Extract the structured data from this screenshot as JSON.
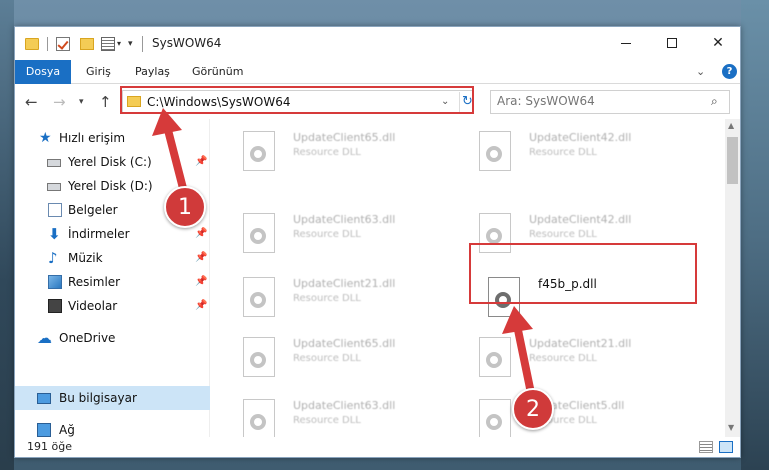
{
  "window": {
    "title": "SysWOW64",
    "min_label": "",
    "close_label": "✕"
  },
  "ribbon": {
    "file_tab": "Dosya",
    "home_tab": "Giriş",
    "share_tab": "Paylaş",
    "view_tab": "Görünüm"
  },
  "nav": {
    "address": "C:\\Windows\\SysWOW64",
    "search_placeholder": "Ara: SysWOW64"
  },
  "sidebar": {
    "items": [
      {
        "label": "Hızlı erişim",
        "icon": "star-icon"
      },
      {
        "label": "Yerel Disk (C:)",
        "icon": "drive-icon"
      },
      {
        "label": "Yerel Disk (D:)",
        "icon": "drive-icon"
      },
      {
        "label": "Belgeler",
        "icon": "documents-icon"
      },
      {
        "label": "İndirmeler",
        "icon": "downloads-icon"
      },
      {
        "label": "Müzik",
        "icon": "music-icon"
      },
      {
        "label": "Resimler",
        "icon": "pictures-icon"
      },
      {
        "label": "Videolar",
        "icon": "videos-icon"
      },
      {
        "label": "OneDrive",
        "icon": "cloud-icon"
      },
      {
        "label": "Bu bilgisayar",
        "icon": "computer-icon"
      },
      {
        "label": "Ağ",
        "icon": "network-icon"
      }
    ]
  },
  "files": [
    {
      "name": "UpdateClient65.dll",
      "type": "Resource DLL"
    },
    {
      "name": "UpdateClient42.dll",
      "type": "Resource DLL"
    },
    {
      "name": "UpdateClient63.dll",
      "type": "Resource DLL"
    },
    {
      "name": "UpdateClient42.dll",
      "type": "Resource DLL"
    },
    {
      "name": "UpdateClient21.dll",
      "type": "Resource DLL"
    },
    {
      "name": "f45b_p.dll",
      "type": ""
    },
    {
      "name": "UpdateClient65.dll",
      "type": "Resource DLL"
    },
    {
      "name": "UpdateClient21.dll",
      "type": "Resource DLL"
    },
    {
      "name": "UpdateClient63.dll",
      "type": "Resource DLL"
    },
    {
      "name": "UpdateClient5.dll",
      "type": "Resource DLL"
    }
  ],
  "status": {
    "item_count": "191 öğe"
  },
  "annotations": {
    "step1": "1",
    "step2": "2",
    "color": "#d63a3a"
  },
  "colors": {
    "accent": "#1a6fc4",
    "selected": "#cce4f7"
  }
}
